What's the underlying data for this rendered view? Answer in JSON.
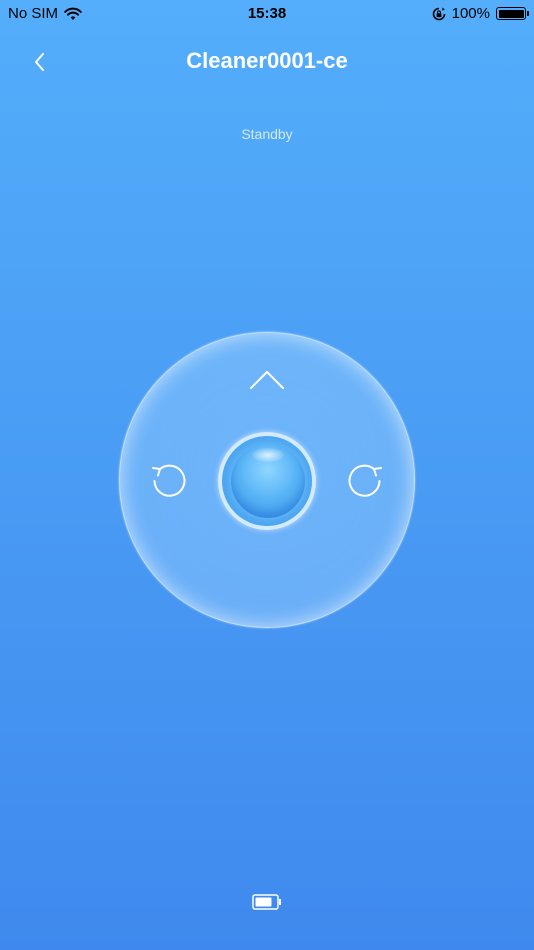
{
  "status_bar": {
    "carrier": "No SIM",
    "time": "15:38",
    "battery_percent": "100%",
    "battery_level": 1.0,
    "icons": [
      "wifi-icon",
      "orientation-lock-icon",
      "battery-icon"
    ]
  },
  "nav": {
    "title": "Cleaner0001-ce",
    "back_icon": "chevron-left-icon"
  },
  "device": {
    "status": "Standby"
  },
  "controls": {
    "up_icon": "chevron-up-icon",
    "rotate_left_icon": "rotate-left-icon",
    "rotate_right_icon": "rotate-right-icon",
    "center_icon": "start-button"
  },
  "footer": {
    "icon": "battery-icon",
    "battery_level": 0.8
  },
  "colors": {
    "background_top": "#54aefb",
    "background_bottom": "#3f89ee",
    "text": "#ffffff"
  }
}
